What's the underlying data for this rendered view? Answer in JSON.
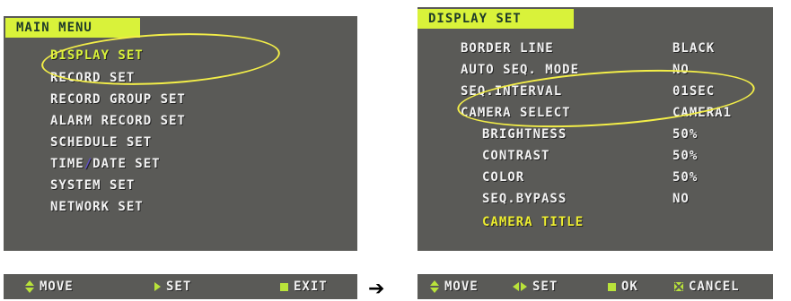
{
  "main_menu": {
    "title": "MAIN MENU",
    "items": [
      {
        "label": "DISPLAY SET"
      },
      {
        "label": "RECORD SET"
      },
      {
        "label": "RECORD GROUP SET"
      },
      {
        "label": "ALARM RECORD SET"
      },
      {
        "label": "SCHEDULE SET"
      },
      {
        "label": "TIME",
        "label2": "/",
        "label3": "DATE SET"
      },
      {
        "label": "SYSTEM SET"
      },
      {
        "label": "NETWORK SET"
      }
    ],
    "footer": {
      "move": "MOVE",
      "set": "SET",
      "exit": "EXIT"
    }
  },
  "display_set": {
    "title": "DISPLAY SET",
    "rows": [
      {
        "label": "BORDER LINE",
        "value": "BLACK"
      },
      {
        "label": "AUTO SEQ. MODE",
        "value": "NO"
      },
      {
        "label": "SEQ.INTERVAL",
        "value": "01SEC"
      },
      {
        "label": "CAMERA SELECT",
        "value": "CAMERA1"
      },
      {
        "label": "BRIGHTNESS",
        "value": "50%"
      },
      {
        "label": "CONTRAST",
        "value": "50%"
      },
      {
        "label": "COLOR",
        "value": "50%"
      },
      {
        "label": "SEQ.BYPASS",
        "value": "NO"
      },
      {
        "label": "CAMERA TITLE",
        "value": ""
      }
    ],
    "footer": {
      "move": "MOVE",
      "set": "SET",
      "ok": "OK",
      "cancel": "CANCEL"
    }
  },
  "transition_arrow": "➔",
  "colors": {
    "osd_bg": "#5a5a57",
    "title_bg": "#d9f23a",
    "highlight": "#ecec30",
    "ellipse": "#f3ee48"
  }
}
